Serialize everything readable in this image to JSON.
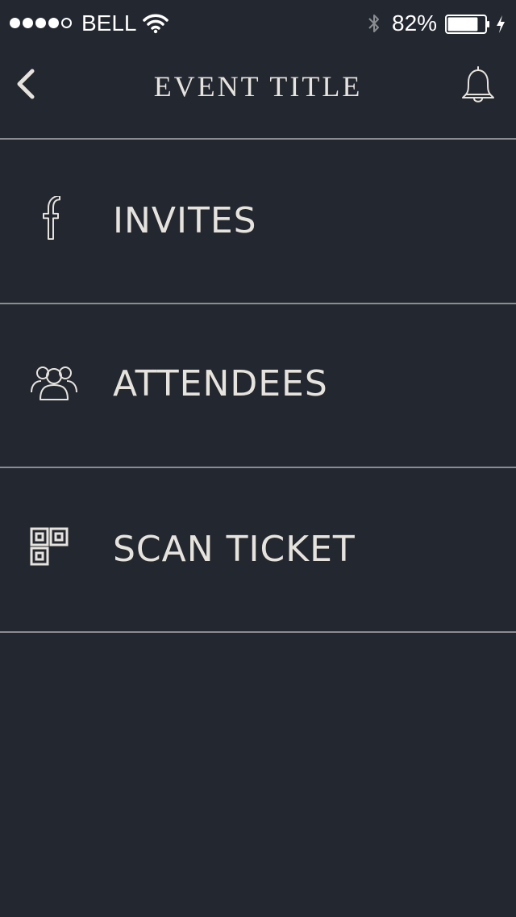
{
  "status_bar": {
    "signal_bars_filled": 4,
    "signal_bars_total": 5,
    "carrier": "BELL",
    "wifi_icon": "wifi-icon",
    "bluetooth_icon": "bluetooth-icon",
    "battery_percent_text": "82%",
    "battery_level": 0.82,
    "charging_icon": "charging-bolt-icon"
  },
  "nav": {
    "back_icon": "chevron-left-icon",
    "title": "EVENT TITLE",
    "notification_icon": "bell-icon"
  },
  "menu": {
    "items": [
      {
        "icon": "facebook-icon",
        "label": "INVITES"
      },
      {
        "icon": "people-group-icon",
        "label": "ATTENDEES"
      },
      {
        "icon": "qr-code-icon",
        "label": "SCAN TICKET"
      }
    ]
  },
  "colors": {
    "background": "#232830",
    "text": "#e6e3dd",
    "divider": "#8a8c90",
    "status_text": "#ffffff"
  }
}
